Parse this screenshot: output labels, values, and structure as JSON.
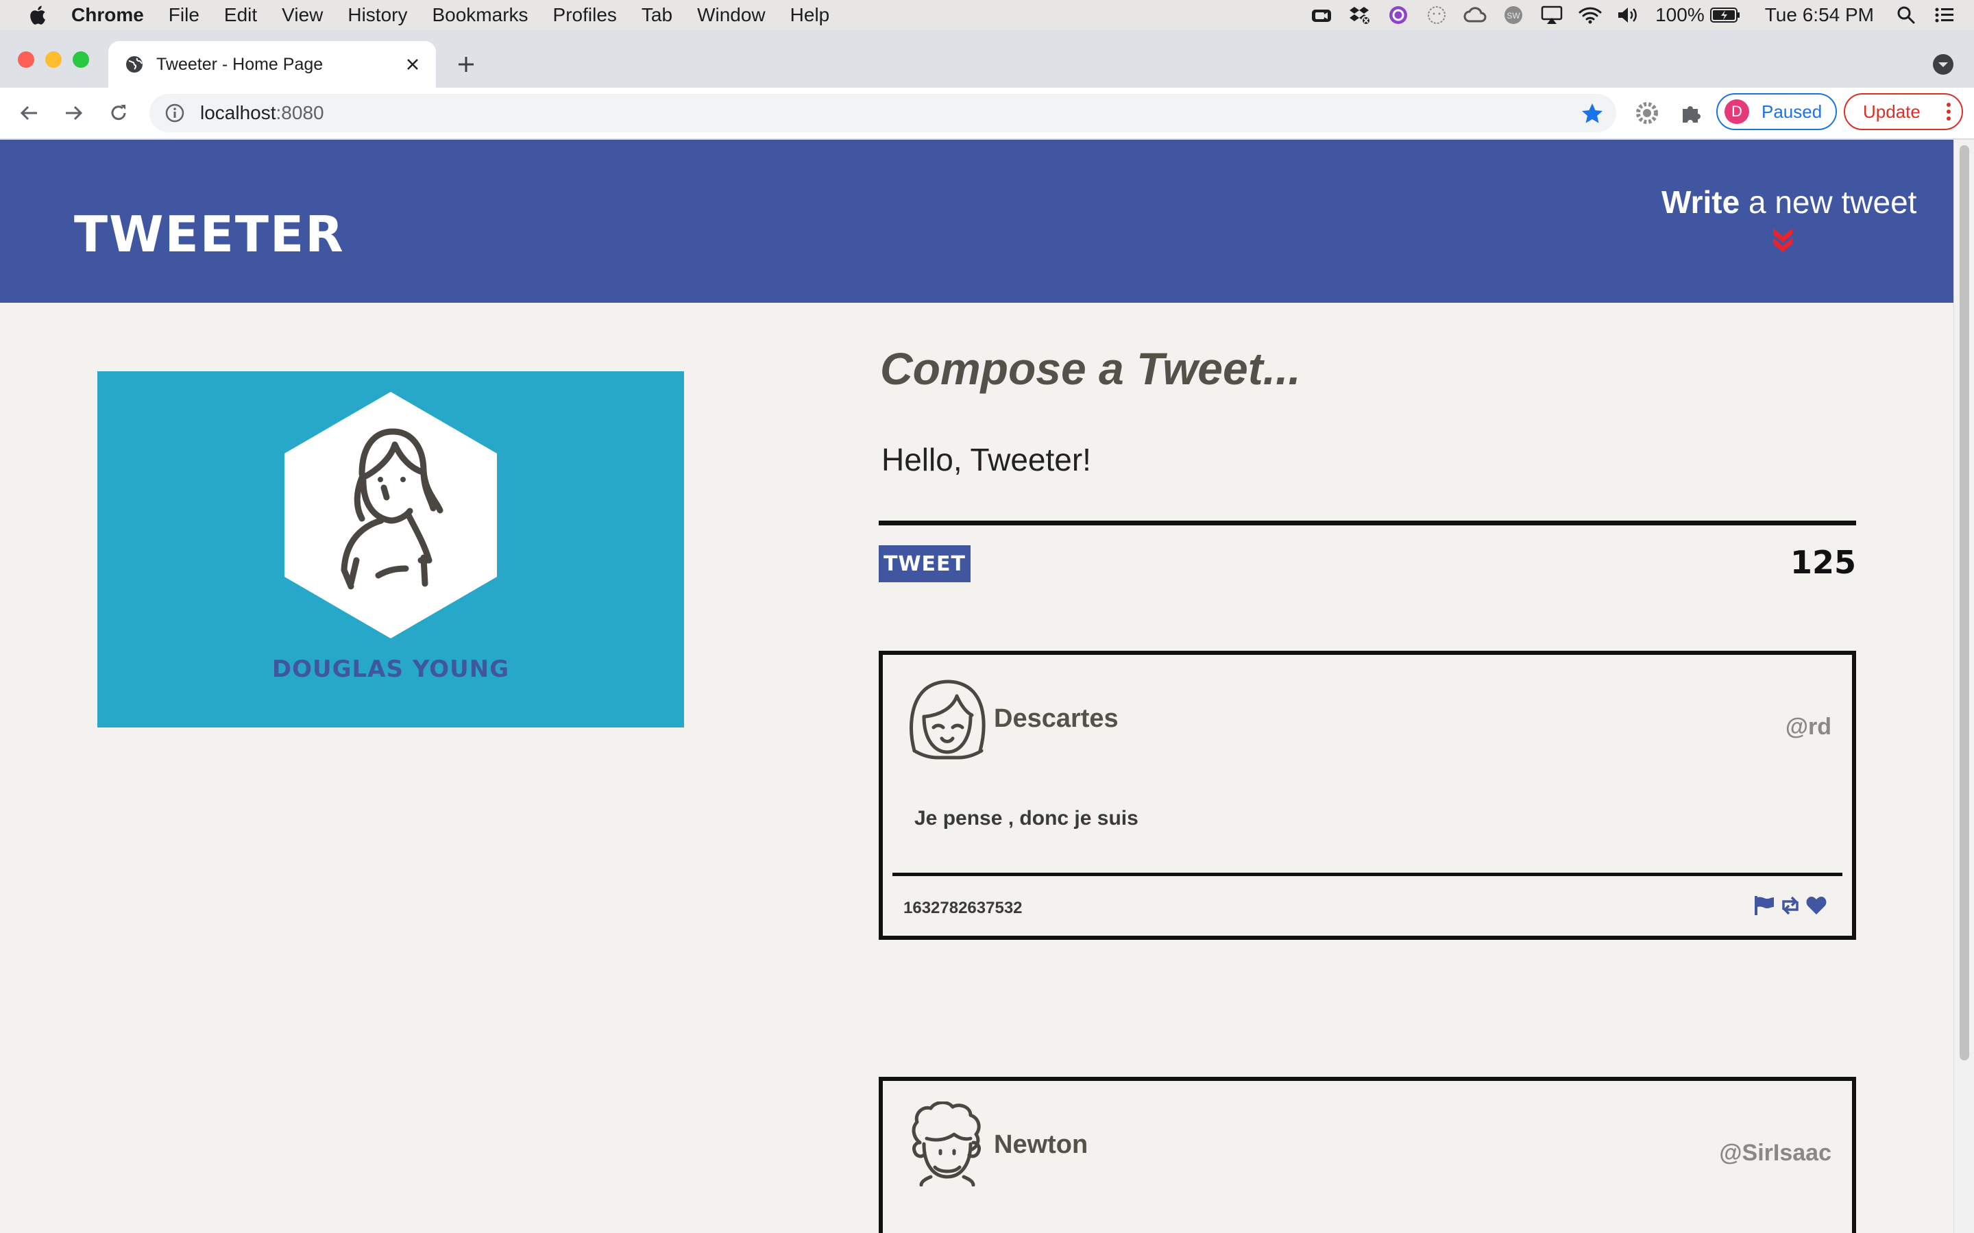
{
  "menubar": {
    "app": "Chrome",
    "items": [
      "File",
      "Edit",
      "View",
      "History",
      "Bookmarks",
      "Profiles",
      "Tab",
      "Window",
      "Help"
    ],
    "battery": "100%",
    "clock": "Tue 6:54 PM"
  },
  "browser": {
    "tab_title": "Tweeter - Home Page",
    "url_host": "localhost",
    "url_port": ":8080",
    "profile_initial": "D",
    "profile_status": "Paused",
    "update_label": "Update"
  },
  "header": {
    "brand": "TWEETER",
    "write_bold": "Write",
    "write_rest": " a new tweet",
    "chevron_color": "#e8232b"
  },
  "profile": {
    "name": "DOUGLAS YOUNG",
    "card_color": "#27a8c8"
  },
  "compose": {
    "title": "Compose a Tweet...",
    "text": "Hello, Tweeter!",
    "button": "TWEET",
    "counter": "125"
  },
  "tweets": [
    {
      "name": "Descartes",
      "handle": "@rd",
      "content": "Je pense , donc je suis",
      "timestamp": "1632782637532",
      "avatar_icon": "girl-avatar-icon"
    },
    {
      "name": "Newton",
      "handle": "@SirIsaac",
      "avatar_icon": "curly-hair-avatar-icon"
    }
  ],
  "colors": {
    "header_bg": "#4056a1",
    "page_bg": "#f4f2ee",
    "accent": "#4056a1"
  }
}
